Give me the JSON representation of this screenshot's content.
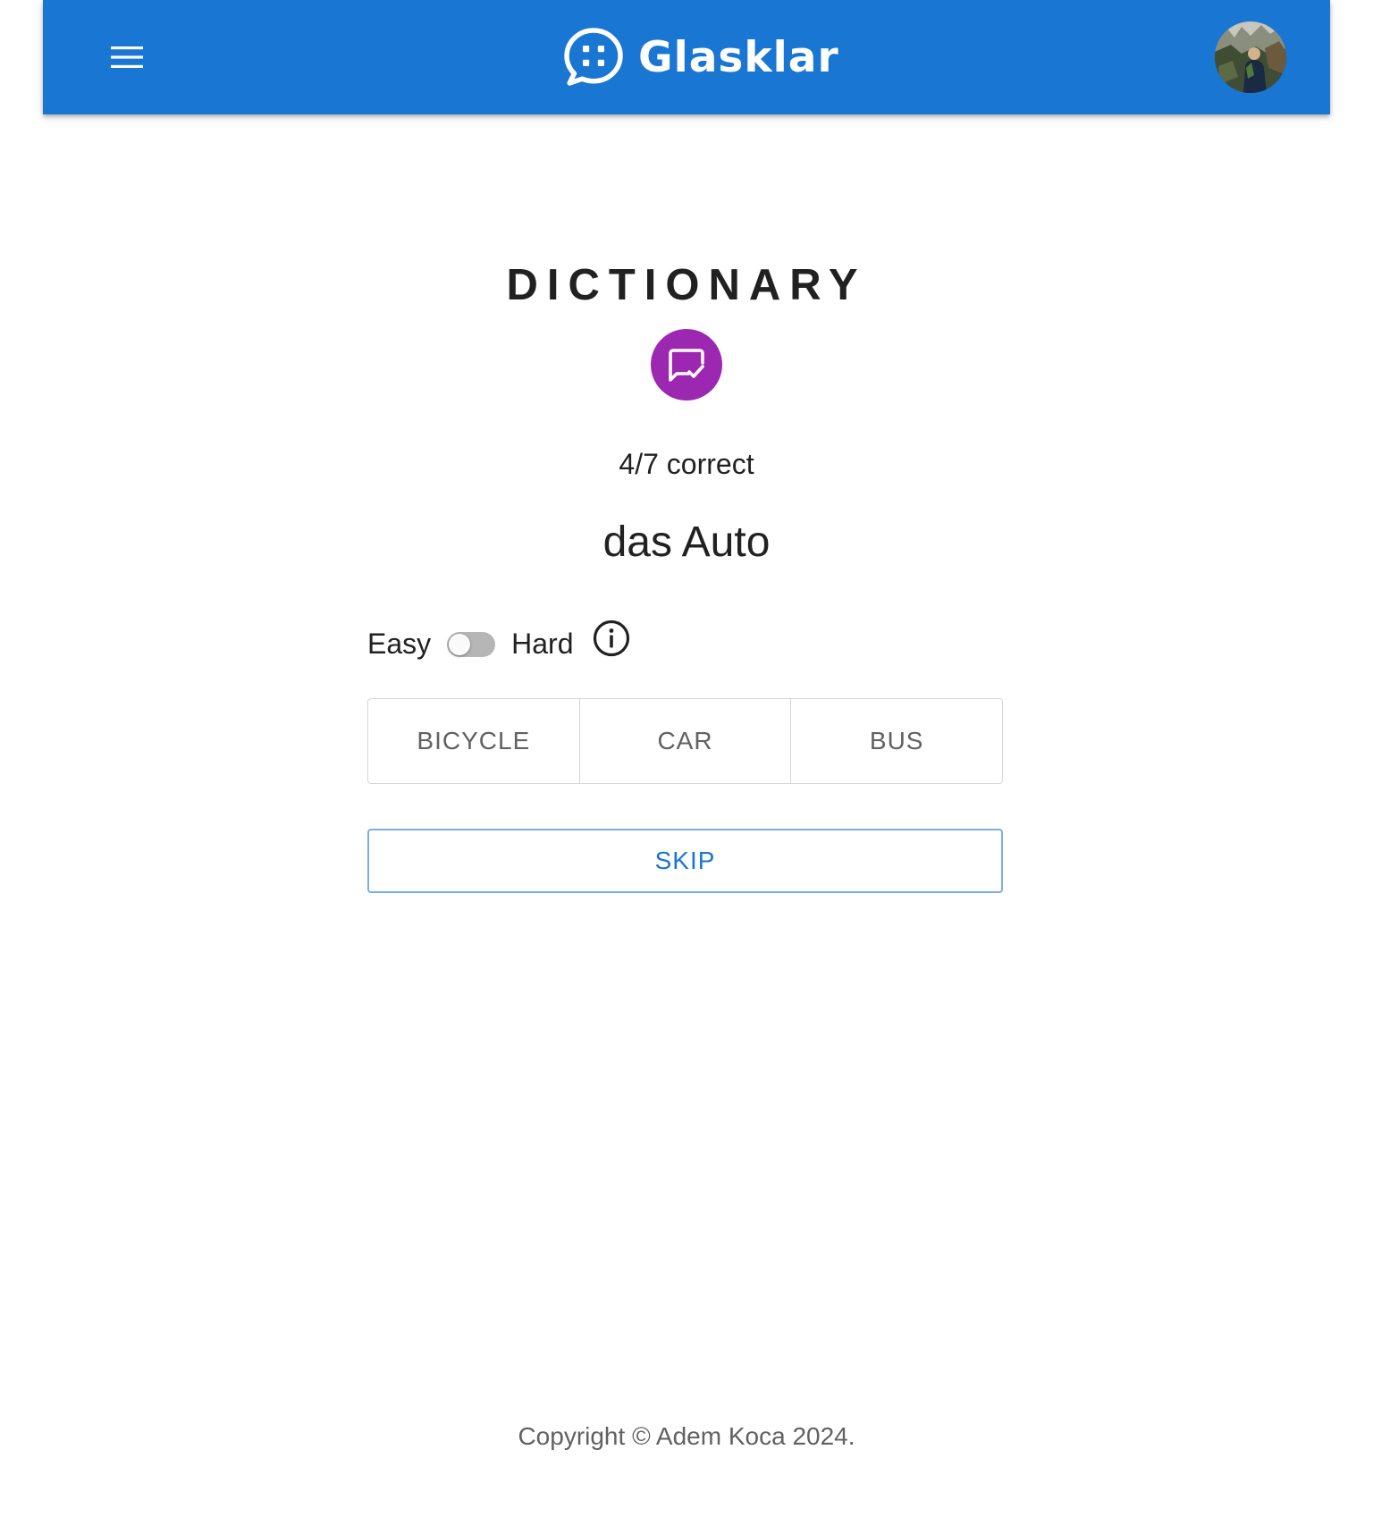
{
  "appbar": {
    "brand_name": "Glasklar",
    "color": "#1976d2",
    "menu_icon": "hamburger-menu-icon",
    "logo_icon": "chat-bubble-dots-icon",
    "avatar_label": "user-avatar"
  },
  "main": {
    "title": "DICTIONARY",
    "badge_icon": "rate-review-check-icon",
    "badge_color": "#9c27b0",
    "score": "4/7 correct",
    "word": "das Auto",
    "difficulty": {
      "easy_label": "Easy",
      "hard_label": "Hard",
      "hard_enabled": false,
      "info_icon": "info-icon"
    },
    "options": [
      {
        "label": "BICYCLE"
      },
      {
        "label": "CAR"
      },
      {
        "label": "BUS"
      }
    ],
    "skip_label": "SKIP"
  },
  "footer": {
    "copyright": "Copyright © Adem Koca 2024."
  }
}
